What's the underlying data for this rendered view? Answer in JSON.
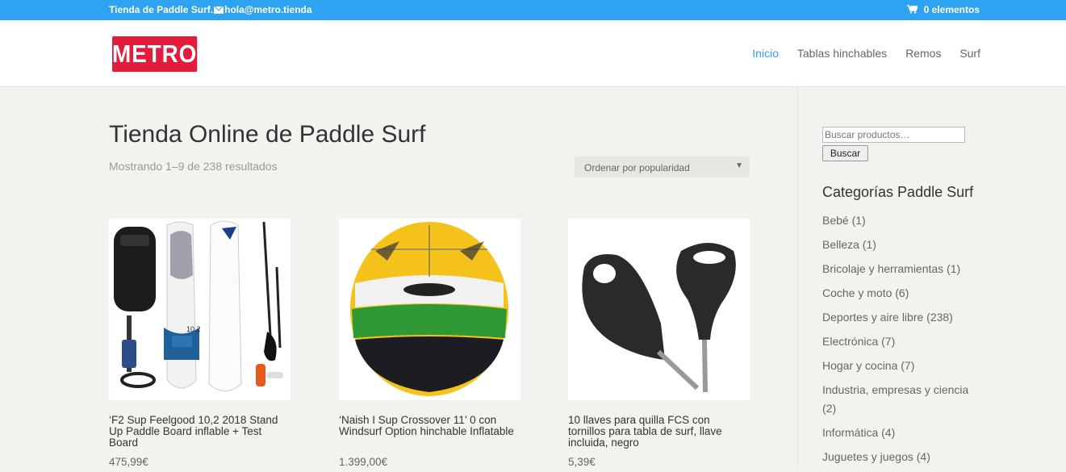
{
  "topbar": {
    "site_name": "Tienda de Paddle Surf.",
    "email": "hola@metro.tienda",
    "cart_label": "0 elementos",
    "color": "#2ea3f2"
  },
  "header": {
    "logo_text": "METRO",
    "logo_color": "#e31c3d",
    "nav": [
      {
        "label": "Inicio",
        "active": true
      },
      {
        "label": "Tablas hinchables",
        "active": false
      },
      {
        "label": "Remos",
        "active": false
      },
      {
        "label": "Surf",
        "active": false
      }
    ]
  },
  "main": {
    "title": "Tienda Online de Paddle Surf",
    "result_count": "Mostrando 1–9 de 238 resultados",
    "order_select": "Ordenar por popularidad",
    "products": [
      {
        "title": "‘F2 Sup Feelgood 10,2 2018 Stand Up Paddle Board inflable + Test Board",
        "price": "475,99€"
      },
      {
        "title": "‘Naish I Sup Crossover 11’ 0 con Windsurf Option hinchable Inflatable",
        "price": "1.399,00€"
      },
      {
        "title": "10 llaves para quilla FCS con tornillos para tabla de surf, llave incluida, negro",
        "price": "5,39€"
      }
    ]
  },
  "sidebar": {
    "search_placeholder": "Buscar productos…",
    "search_button": "Buscar",
    "categories_title": "Categorías Paddle Surf",
    "categories": [
      "Bebé (1)",
      "Belleza (1)",
      "Bricolaje y herramientas (1)",
      "Coche y moto (6)",
      "Deportes y aire libre (238)",
      "Electrónica (7)",
      "Hogar y cocina (7)",
      "Industria, empresas y ciencia (2)",
      "Informática (4)",
      "Juguetes y juegos (4)"
    ]
  }
}
